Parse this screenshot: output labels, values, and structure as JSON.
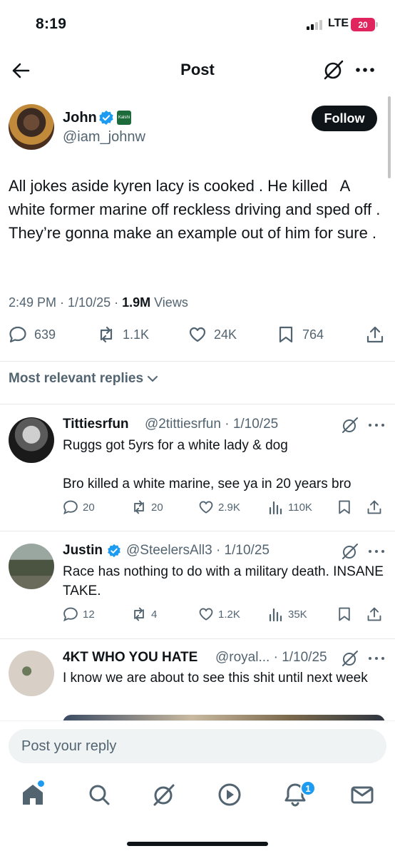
{
  "status_bar": {
    "time": "8:19",
    "network": "LTE",
    "battery": "20"
  },
  "header": {
    "title": "Post"
  },
  "post": {
    "author_name": "John",
    "affiliate_badge": "Kalshi",
    "handle": "@iam_johnw",
    "follow_label": "Follow",
    "text": "All jokes aside kyren lacy is cooked . He killed   A white former marine off reckless driving and sped off . They’re gonna make an example out of him for sure .",
    "time_date": "2:49 PM · 1/10/25 · ",
    "views_count": "1.9M",
    "views_label": " Views",
    "stats": {
      "replies": "639",
      "reposts": "1.1K",
      "likes": "24K",
      "bookmarks": "764"
    }
  },
  "replies_filter": "Most relevant replies",
  "replies": [
    {
      "name": "Tittiesrfun",
      "handle_date": "@2tittiesrfun · 1/10/25",
      "text": "Ruggs got 5yrs for a white lady & dog\n\nBro killed a white marine, see ya in 20 years bro",
      "replies": "20",
      "reposts": "20",
      "likes": "2.9K",
      "views": "110K"
    },
    {
      "name": "Justin",
      "handle_date": "@SteelersAll3 · 1/10/25",
      "text": "Race has nothing to do with a military death. INSANE TAKE.",
      "replies": "12",
      "reposts": "4",
      "likes": "1.2K",
      "views": "35K"
    },
    {
      "name": "4KT WHO YOU HATE",
      "handle_date": "@royal... · 1/10/25",
      "text": "I know we are about to see this shit until next week"
    }
  ],
  "composer": {
    "placeholder": "Post your reply"
  },
  "nav": {
    "notifications_badge": "1"
  },
  "colors": {
    "accent": "#1d9bf0",
    "text": "#0f1419",
    "secondary": "#536471",
    "battery": "#e0245e"
  },
  "icons": [
    "back-arrow-icon",
    "grok-icon",
    "more-icon",
    "verified-icon",
    "reply-icon",
    "repost-icon",
    "like-icon",
    "bookmark-icon",
    "share-icon",
    "views-icon",
    "home-icon",
    "search-icon",
    "play-icon",
    "bell-icon",
    "mail-icon"
  ]
}
